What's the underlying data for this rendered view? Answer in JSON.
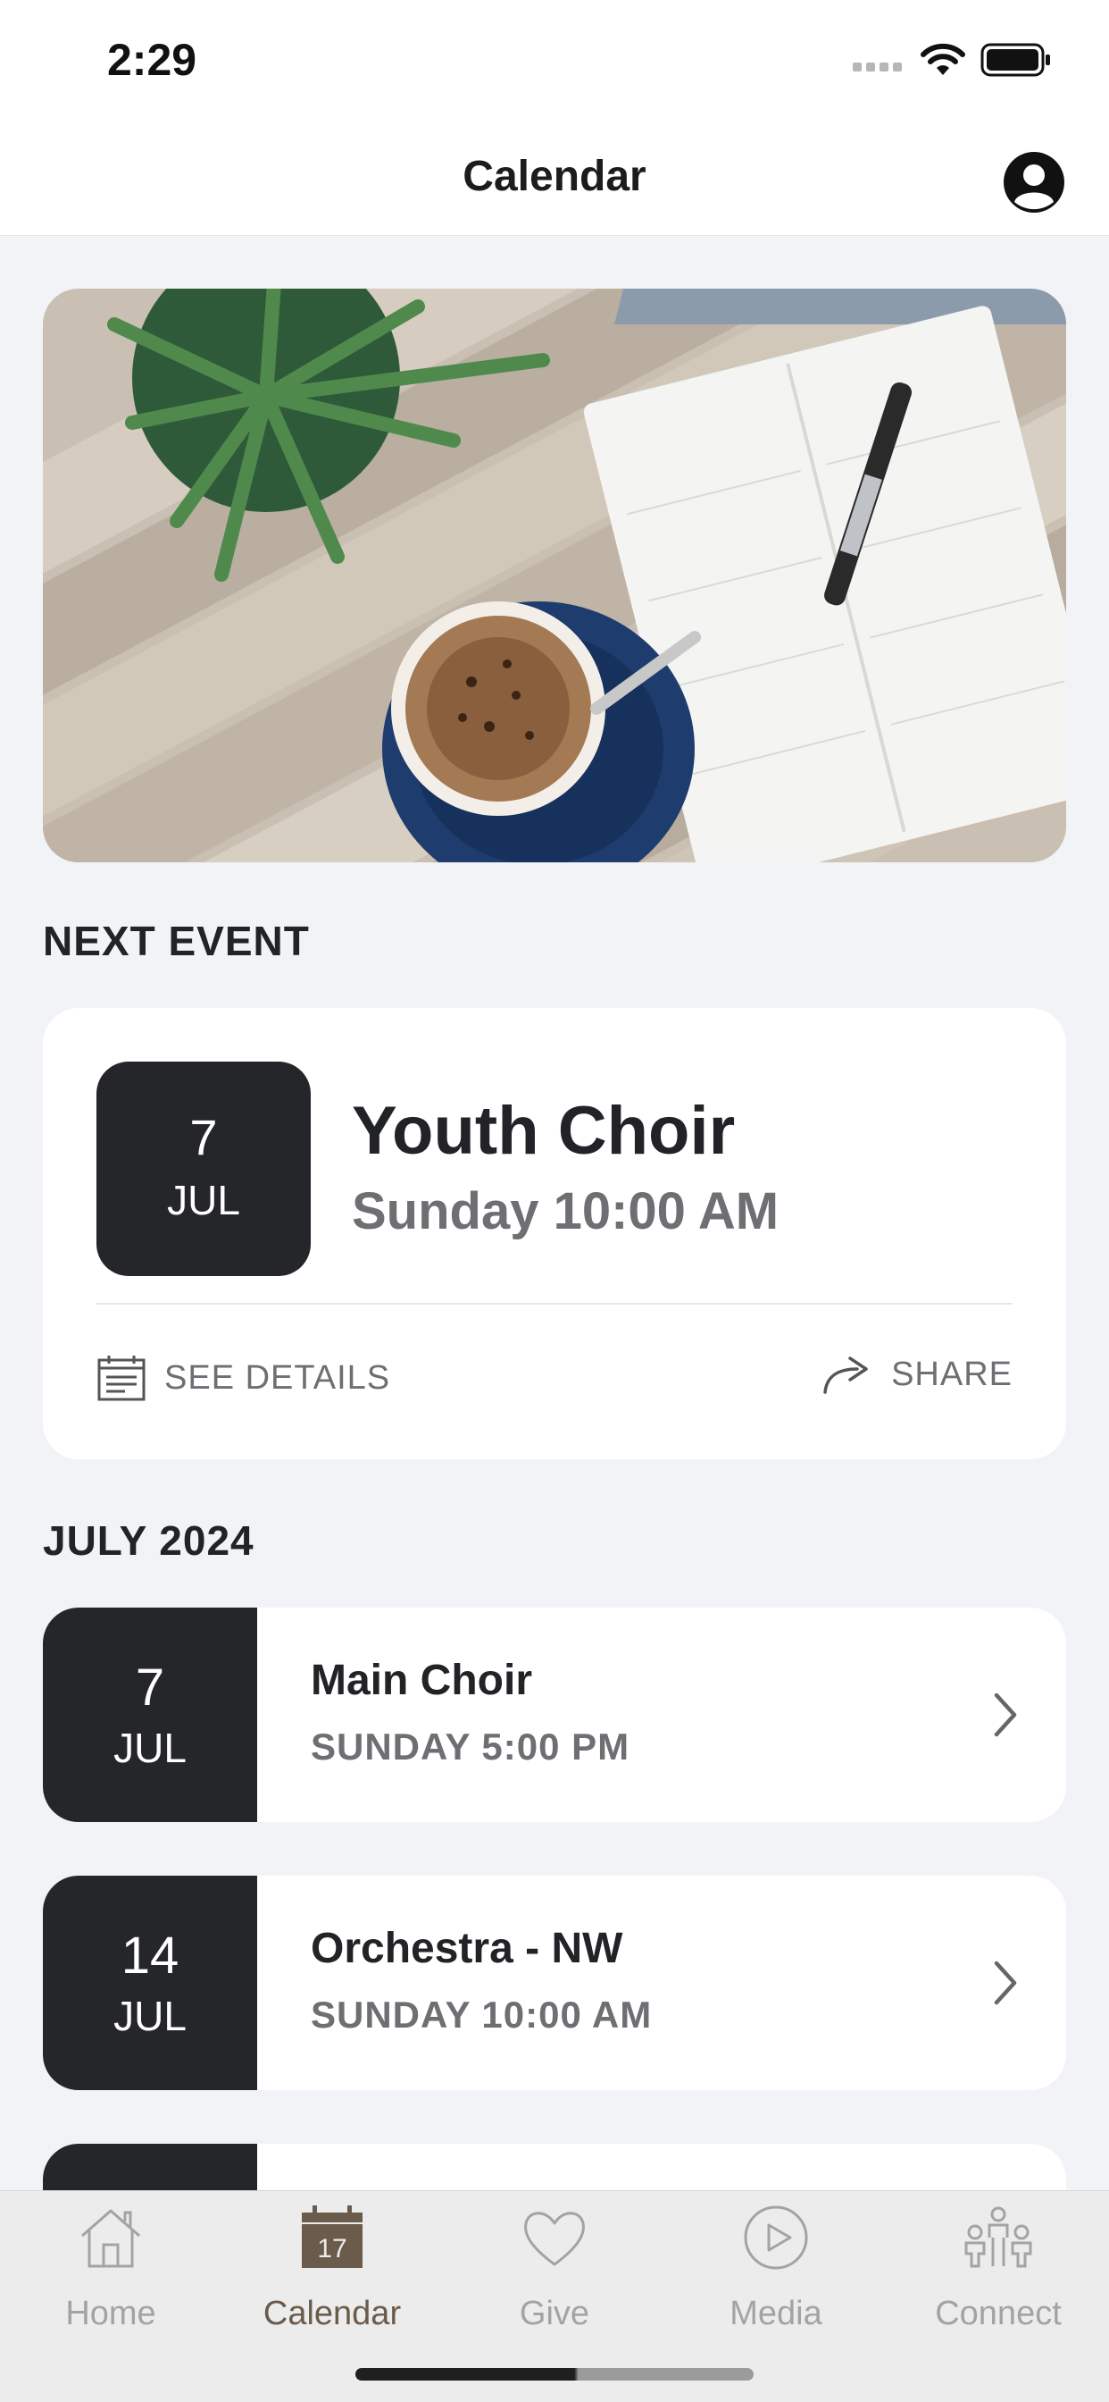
{
  "status_bar": {
    "time": "2:29"
  },
  "nav": {
    "title": "Calendar"
  },
  "hero": {
    "alt": "Coffee cup, plant and planner on wooden table"
  },
  "next_event": {
    "section_title": "NEXT EVENT",
    "day": "7",
    "month": "JUL",
    "title": "Youth Choir",
    "time": "Sunday 10:00 AM",
    "see_details_label": "SEE DETAILS",
    "share_label": "SHARE"
  },
  "month_section": {
    "title": "JULY 2024"
  },
  "events": [
    {
      "day": "7",
      "month": "JUL",
      "title": "Main Choir",
      "time": "SUNDAY 5:00 PM"
    },
    {
      "day": "14",
      "month": "JUL",
      "title": "Orchestra - NW",
      "time": "SUNDAY 10:00 AM"
    }
  ],
  "tabs": [
    {
      "label": "Home",
      "icon": "home-icon"
    },
    {
      "label": "Calendar",
      "icon": "calendar-icon",
      "calendar_number": "17",
      "active": true
    },
    {
      "label": "Give",
      "icon": "heart-icon"
    },
    {
      "label": "Media",
      "icon": "play-icon"
    },
    {
      "label": "Connect",
      "icon": "people-icon"
    }
  ],
  "colors": {
    "background": "#f2f3f7",
    "date_block": "#252629",
    "active_tab": "#6b5b4b",
    "inactive_tab": "#a3a3a3",
    "secondary_text": "#6e6e73"
  }
}
